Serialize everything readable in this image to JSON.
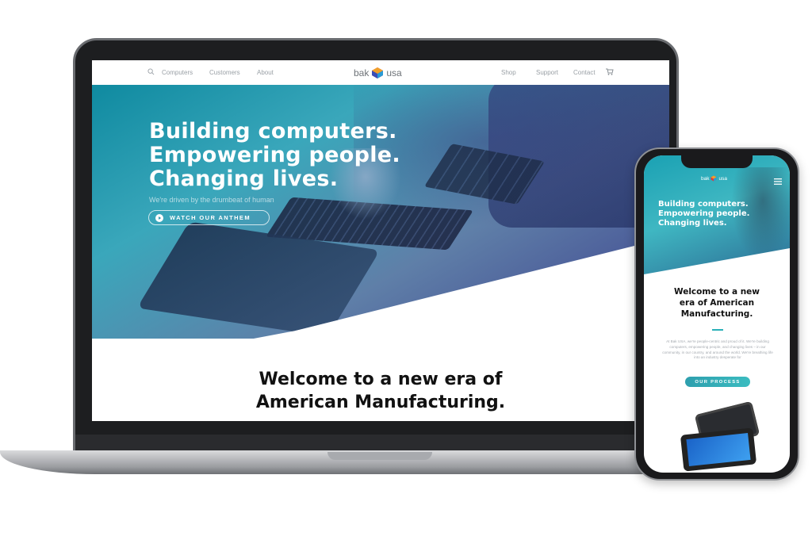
{
  "site": {
    "nav": {
      "left_items": [
        "Computers",
        "Customers",
        "About"
      ],
      "right_items": [
        "Shop",
        "Support",
        "Contact"
      ],
      "logo_left": "bak",
      "logo_right": "usa"
    },
    "hero": {
      "title_lines": [
        "Building computers.",
        "Empowering people.",
        "Changing lives."
      ],
      "subtitle": "We're driven by the drumbeat of human",
      "button_label": "WATCH OUR ANTHEM"
    },
    "welcome": {
      "lines": [
        "Welcome to a new era of",
        "American Manufacturing."
      ]
    }
  },
  "mobile": {
    "logo_left": "bak",
    "logo_right": "usa",
    "hero_title_lines": [
      "Building computers.",
      "Empowering people.",
      "Changing lives."
    ],
    "welcome_lines": [
      "Welcome to a new",
      "era of American",
      "Manufacturing."
    ],
    "body_text": "At Bak USA, we're people-centric and proud of it. We're building computers, empowering people, and changing lives – in our community, in our country, and around the world. We're breathing life into an industry desperate for",
    "button_label": "OUR PROCESS"
  },
  "colors": {
    "teal": "#2ab0b8",
    "hero_navy": "#3b3f8d",
    "text_dark": "#111111",
    "nav_gray": "#9aa0a6"
  },
  "icons": [
    "search-icon",
    "cart-icon",
    "play-icon",
    "menu-icon",
    "logo-mark"
  ]
}
